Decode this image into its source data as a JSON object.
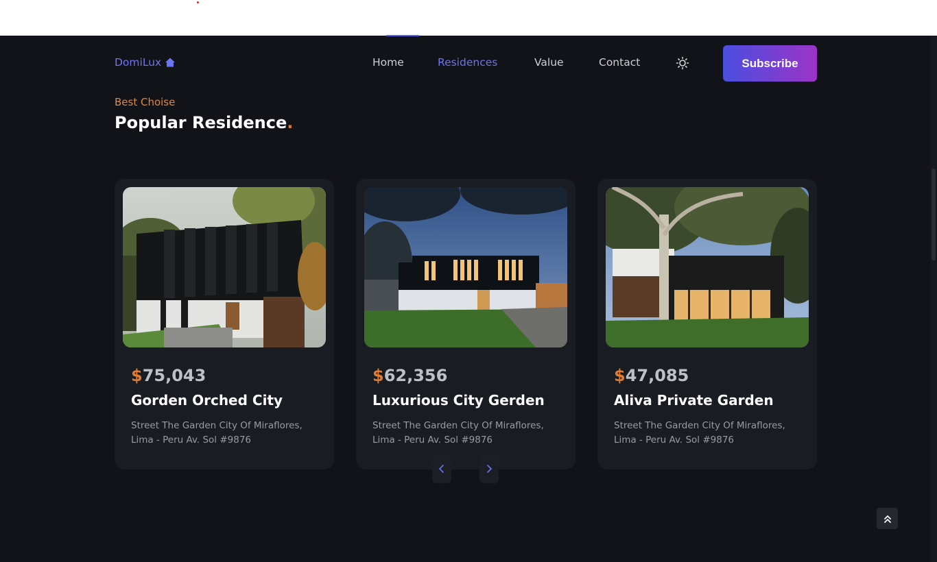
{
  "header": {
    "logo_text": "DomiLux",
    "nav": [
      {
        "label": "Home"
      },
      {
        "label": "Residences",
        "active": true
      },
      {
        "label": "Value"
      },
      {
        "label": "Contact"
      }
    ],
    "theme_icon": "sun-icon",
    "subscribe_label": "Subscribe"
  },
  "section": {
    "subtitle": "Best Choise",
    "title": "Popular Residence",
    "title_accent": "."
  },
  "residences": [
    {
      "currency": "$",
      "price": "75,043",
      "name": "Gorden Orched City",
      "address": "Street The Garden City Of Miraflores, Lima - Peru Av. Sol #9876"
    },
    {
      "currency": "$",
      "price": "62,356",
      "name": "Luxurious City Gerden",
      "address": "Street The Garden City Of Miraflores, Lima - Peru Av. Sol #9876"
    },
    {
      "currency": "$",
      "price": "47,085",
      "name": "Aliva Private Garden",
      "address": "Street The Garden City Of Miraflores, Lima - Peru Av. Sol #9876"
    }
  ],
  "slider": {
    "prev_icon": "chevron-left-icon",
    "next_icon": "chevron-right-icon"
  },
  "scroll_top_icon": "double-chevron-up-icon",
  "colors": {
    "background": "#121318",
    "card": "#1a1c23",
    "accent_blue": "#6b74f2",
    "accent_orange": "#e07a2e",
    "subscribe_gradient_start": "#4a4ee0",
    "subscribe_gradient_end": "#9b34c8"
  }
}
